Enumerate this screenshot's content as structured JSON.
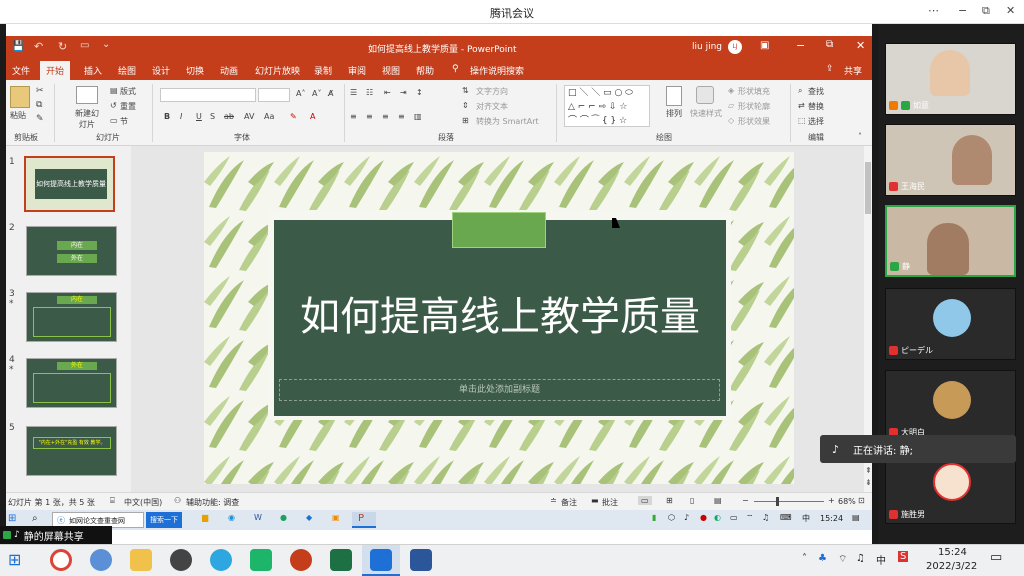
{
  "meeting": {
    "title": "腾讯会议",
    "controls": [
      "⋯",
      "−",
      "⧉",
      "✕"
    ]
  },
  "ppt": {
    "doc_title": "如何提高线上教学质量 - PowerPoint",
    "user": "liu jing",
    "user_initial": "LJ",
    "share_label": "共享",
    "tabs": [
      "文件",
      "开始",
      "插入",
      "绘图",
      "设计",
      "切换",
      "动画",
      "幻灯片放映",
      "录制",
      "审阅",
      "视图",
      "帮助"
    ],
    "tell_me": "操作说明搜索",
    "ribbon": {
      "paste": "粘贴",
      "new_slide": "新建幻灯片",
      "layout": "版式",
      "reset": "重置",
      "section": "节",
      "text_dir": "文字方向",
      "align_text": "对齐文本",
      "smartart": "转换为 SmartArt",
      "arrange": "排列",
      "quick_styles": "快速样式",
      "shape_fill": "形状填充",
      "shape_outline": "形状轮廓",
      "shape_effect": "形状效果",
      "find": "查找",
      "replace": "替换",
      "select": "选择",
      "groups": {
        "clipboard": "剪贴板",
        "slides": "幻灯片",
        "font": "字体",
        "paragraph": "段落",
        "drawing": "绘图",
        "editing": "编辑"
      }
    },
    "thumbnails": [
      {
        "num": "1",
        "star": "",
        "title": "如何提高线上教学质量"
      },
      {
        "num": "2",
        "star": "",
        "title": "内在 · 外在"
      },
      {
        "num": "3",
        "star": "*",
        "title": "内在"
      },
      {
        "num": "4",
        "star": "*",
        "title": "外在"
      },
      {
        "num": "5",
        "star": "",
        "title": "\"内在+外在\"充盈 有效 教学。"
      }
    ],
    "slide": {
      "title": "如何提高线上教学质量",
      "subtitle_placeholder": "单击此处添加副标题"
    },
    "status": {
      "slide_info": "幻灯片 第 1 张，共 5 张",
      "language": "中文(中国)",
      "accessibility": "辅助功能: 调查",
      "notes": "备注",
      "comments": "批注",
      "zoom": "68%"
    }
  },
  "inner_taskbar": {
    "search_tab": "如网论文查重查网",
    "search_btn": "搜索一下",
    "time": "15:24",
    "ime": "中"
  },
  "video": {
    "participants": [
      {
        "name": "如意",
        "mic": "on"
      },
      {
        "name": "王海民",
        "mic": "off"
      },
      {
        "name": "静",
        "mic": "on"
      },
      {
        "name": "ピーデル",
        "mic": "off"
      },
      {
        "name": "大明白",
        "mic": "off"
      },
      {
        "name": "施胜男",
        "mic": "off"
      }
    ]
  },
  "share": {
    "label": "静的屏幕共享"
  },
  "speaking": {
    "label": "正在讲话: 静;"
  },
  "taskbar": {
    "time": "15:24",
    "date": "2022/3/22",
    "ime": "中"
  },
  "colors": {
    "ppt_red": "#c43e1c",
    "slide_green": "#3c5a48",
    "accent_green": "#6aa84f"
  }
}
